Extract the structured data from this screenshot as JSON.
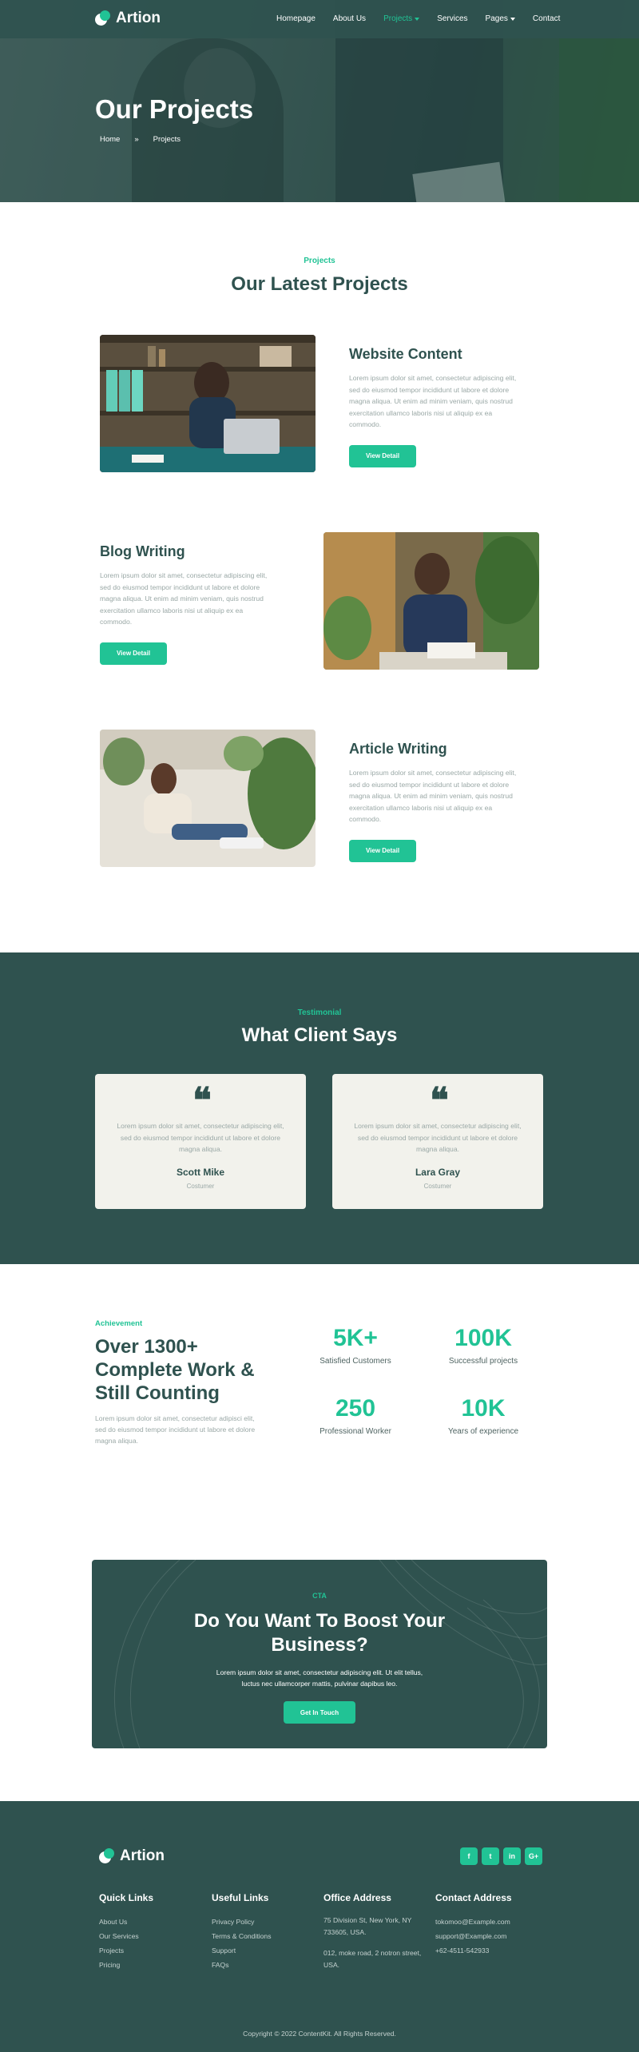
{
  "brand": {
    "name": "Artion",
    "accent": "#21c395",
    "dark": "#2f524f"
  },
  "nav": {
    "items": [
      {
        "label": "Homepage",
        "active": false,
        "dropdown": false
      },
      {
        "label": "About Us",
        "active": false,
        "dropdown": false
      },
      {
        "label": "Projects",
        "active": true,
        "dropdown": true
      },
      {
        "label": "Services",
        "active": false,
        "dropdown": false
      },
      {
        "label": "Pages",
        "active": false,
        "dropdown": true
      },
      {
        "label": "Contact",
        "active": false,
        "dropdown": false
      }
    ]
  },
  "hero": {
    "title": "Our Projects",
    "breadcrumb": [
      "Home",
      "»",
      "Projects"
    ]
  },
  "projects": {
    "label": "Projects",
    "title": "Our Latest Projects",
    "items": [
      {
        "title": "Website Content",
        "desc": "Lorem ipsum dolor sit amet, consectetur adipiscing elit, sed do eiusmod tempor incididunt ut labore et dolore magna aliqua. Ut enim ad minim veniam, quis nostrud exercitation ullamco laboris nisi ut aliquip ex ea commodo.",
        "button": "View Detail"
      },
      {
        "title": "Blog Writing",
        "desc": "Lorem ipsum dolor sit amet, consectetur adipiscing elit, sed do eiusmod tempor incididunt ut labore et dolore magna aliqua. Ut enim ad minim veniam, quis nostrud exercitation ullamco laboris nisi ut aliquip ex ea commodo.",
        "button": "View Detail"
      },
      {
        "title": "Article Writing",
        "desc": "Lorem ipsum dolor sit amet, consectetur adipiscing elit, sed do eiusmod tempor incididunt ut labore et dolore magna aliqua. Ut enim ad minim veniam, quis nostrud exercitation ullamco laboris nisi ut aliquip ex ea commodo.",
        "button": "View Detail"
      }
    ]
  },
  "testimonial": {
    "label": "Testimonial",
    "title": "What Client Says",
    "quote_glyph": "❝",
    "items": [
      {
        "text": "Lorem ipsum dolor sit amet, consectetur adipiscing elit, sed do eiusmod tempor incididunt ut labore et dolore magna aliqua.",
        "name": "Scott Mike",
        "role": "Costumer"
      },
      {
        "text": "Lorem ipsum dolor sit amet, consectetur adipiscing elit, sed do eiusmod tempor incididunt ut labore et dolore magna aliqua.",
        "name": "Lara Gray",
        "role": "Costumer"
      }
    ]
  },
  "achievement": {
    "label": "Achievement",
    "title": "Over 1300+ Complete Work & Still Counting",
    "desc": "Lorem ipsum dolor sit amet, consectetur adipisci elit, sed do eiusmod tempor incididunt ut labore et dolore magna aliqua.",
    "stats": [
      {
        "value": "5K+",
        "label": "Satisfied Customers"
      },
      {
        "value": "100K",
        "label": "Successful projects"
      },
      {
        "value": "250",
        "label": "Professional Worker"
      },
      {
        "value": "10K",
        "label": "Years of experience"
      }
    ]
  },
  "cta": {
    "label": "CTA",
    "title": "Do You Want To Boost Your Business?",
    "text": "Lorem ipsum dolor sit amet, consectetur adipiscing elit. Ut elit tellus, luctus nec ullamcorper mattis, pulvinar dapibus leo.",
    "button": "Get In Touch"
  },
  "footer": {
    "socials": [
      {
        "name": "facebook-icon",
        "glyph": "f"
      },
      {
        "name": "twitter-icon",
        "glyph": "t"
      },
      {
        "name": "linkedin-icon",
        "glyph": "in"
      },
      {
        "name": "google-plus-icon",
        "glyph": "G+"
      }
    ],
    "quick_links": {
      "title": "Quick Links",
      "items": [
        "About Us",
        "Our Services",
        "Projects",
        "Pricing"
      ]
    },
    "useful_links": {
      "title": "Useful Links",
      "items": [
        "Privacy Policy",
        "Terms & Conditions",
        "Support",
        "FAQs"
      ]
    },
    "office": {
      "title": "Office Address",
      "lines": [
        "75 Division St, New York, NY 733605, USA.",
        "012, moke road, 2 notron street, USA."
      ]
    },
    "contact": {
      "title": "Contact Address",
      "items": [
        "tokomoo@Example.com",
        "support@Example.com",
        "+62-4511-542933"
      ]
    },
    "copyright": "Copyright © 2022 ContentKit. All Rights Reserved."
  }
}
